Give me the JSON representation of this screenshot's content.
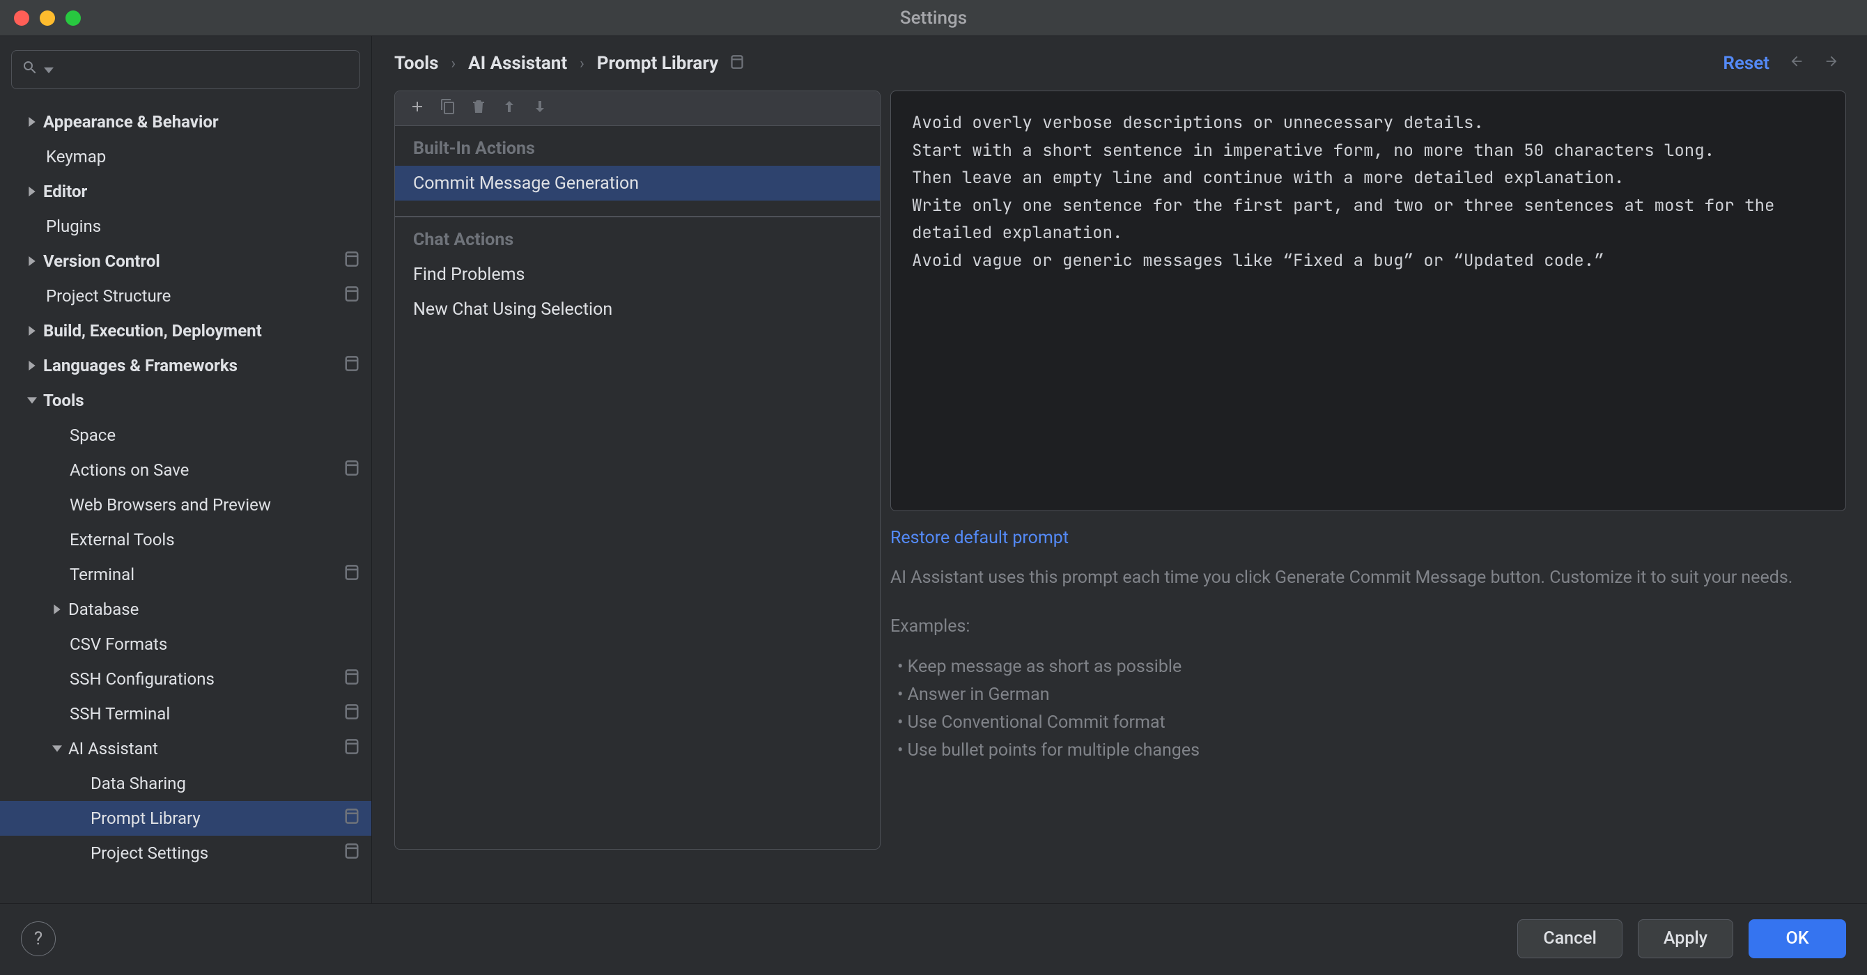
{
  "window": {
    "title": "Settings"
  },
  "breadcrumb": [
    "Tools",
    "AI Assistant",
    "Prompt Library"
  ],
  "reset_label": "Reset",
  "search": {
    "placeholder": ""
  },
  "tree": {
    "appearance": "Appearance & Behavior",
    "keymap": "Keymap",
    "editor": "Editor",
    "plugins": "Plugins",
    "vcs": "Version Control",
    "proj_struct": "Project Structure",
    "bed": "Build, Execution, Deployment",
    "lang_fw": "Languages & Frameworks",
    "tools": "Tools",
    "space": "Space",
    "actions_save": "Actions on Save",
    "web_browsers": "Web Browsers and Preview",
    "ext_tools": "External Tools",
    "terminal": "Terminal",
    "database": "Database",
    "csv": "CSV Formats",
    "ssh_conf": "SSH Configurations",
    "ssh_term": "SSH Terminal",
    "ai_assist": "AI Assistant",
    "data_sharing": "Data Sharing",
    "prompt_lib": "Prompt Library",
    "proj_settings": "Project Settings"
  },
  "actions": {
    "group_builtin": "Built-In Actions",
    "commit_msg_gen": "Commit Message Generation",
    "group_chat": "Chat Actions",
    "find_problems": "Find Problems",
    "new_chat_sel": "New Chat Using Selection"
  },
  "prompt_text": "Avoid overly verbose descriptions or unnecessary details.\nStart with a short sentence in imperative form, no more than 50 characters long.\nThen leave an empty line and continue with a more detailed explanation.\nWrite only one sentence for the first part, and two or three sentences at most for the detailed explanation.\nAvoid vague or generic messages like “Fixed a bug” or “Updated code.”",
  "restore_link": "Restore default prompt",
  "help_text": "AI Assistant uses this prompt each time you click Generate Commit Message button. Customize it to suit your needs.",
  "examples_label": "Examples:",
  "examples": [
    "Keep message as short as possible",
    "Answer in German",
    "Use Conventional Commit format",
    "Use bullet points for multiple changes"
  ],
  "footer": {
    "cancel": "Cancel",
    "apply": "Apply",
    "ok": "OK"
  }
}
